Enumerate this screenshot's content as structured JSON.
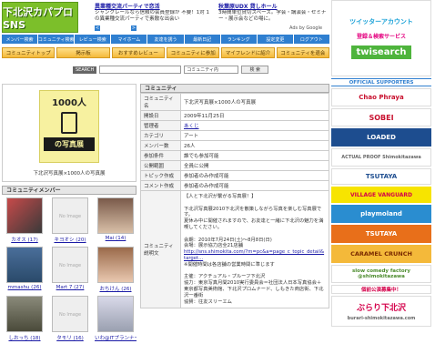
{
  "logo": {
    "text": "下北沢カパプロ SNS"
  },
  "nav": [
    "メンバー検索",
    "コミュニティ検索",
    "レビュー検索",
    "マイホーム",
    "友達を誘う",
    "最新日記",
    "ランキング",
    "設定変更",
    "ログアウト"
  ],
  "ads": {
    "ad1_title": "異業種交流パーティで恋活",
    "ad1_body": "シャンクレールなら信頼の会員登録が 不要！1対 1の異業種交流パーティで素敵な出会い",
    "ad2_title": "秋葉原UDX 貸しホール",
    "ad2_body": "3時間単位貸切スペース。学会・講演会・セミナー・展示会などの場に。",
    "ads_by": "Ads by Google"
  },
  "tabs": [
    "コミュニティトップ",
    "掲示板",
    "おすすめレビュー",
    "コミュニティに参加",
    "マイフレンドに紹介",
    "コミュニティを退会"
  ],
  "search": {
    "label": "SEARCH",
    "select": "コミュニティ内",
    "button": "検 索"
  },
  "community": {
    "poster_top": "1000人",
    "poster_bottom": "の写真展",
    "caption": "下北沢写真展×1000人の写真展",
    "header": "コミュニティ",
    "rows": [
      {
        "label": "コミュニティ名",
        "value": "下北沢写真展×1000人の写真展"
      },
      {
        "label": "開設日",
        "value": "2009年11月25日"
      },
      {
        "label": "管理者",
        "value": "あくじ"
      },
      {
        "label": "カテゴリ",
        "value": "アート"
      },
      {
        "label": "メンバー数",
        "value": "26人"
      },
      {
        "label": "参加条件",
        "value": "誰でも参加可能"
      },
      {
        "label": "公開範囲",
        "value": "全員に公開"
      },
      {
        "label": "トピック作成",
        "value": "参加者のみ作成可能"
      },
      {
        "label": "コメント作成",
        "value": "参加者のみ作成可能"
      }
    ],
    "desc_label": "コミュニティ説明文",
    "description": [
      "【人と下北沢が繋がる写真展！】",
      "下北沢写真展2010下北沢を散策しながら写真を楽しむ写真展です。",
      "夏休み中に開催されますので、お友達と一緒に下北沢の魅力を満喫してください。",
      "会期：2010年7月24日(土)〜8月8日(日)",
      "会場：展示協力店全21店舗",
      "http://sns.shimokita.com/?m=pc&a=page_c_topic_detail&target...",
      "※開催時間は各店舗の営業時間に準じます",
      "主催：アクチュアル・プルーフ下北沢",
      "協力：東京写真月間2010実行委員会＝社団法人日本写真協会＋東京都写真美術館、下北沢プロムナード、しもきた商店街、下北沢一番街",
      "協賛：往友スリーエム"
    ]
  },
  "members": {
    "header": "コミュニティメンバー",
    "list": [
      {
        "name": "カオス (17)"
      },
      {
        "name": "キヨオシ (20)"
      },
      {
        "name": "Mai (14)"
      },
      {
        "name": "mmashu (26)"
      },
      {
        "name": "Mart 7 (27)"
      },
      {
        "name": "おちけん (26)"
      },
      {
        "name": "しおっち (18)"
      },
      {
        "name": "タモリ (16)"
      },
      {
        "name": "いわ@ITプランナー (8)"
      }
    ],
    "noimage": "No Image"
  },
  "right": {
    "twitter_1": "ツイッターアカウント",
    "twitter_2": "登録＆検索サービス",
    "twitter_3": "twisearch",
    "supporters": "OFFICIAL SUPPORTERS",
    "chao": "Chao Phraya",
    "sobei": "SOBEI",
    "loaded": "LOADED",
    "actual": "ACTUAL PROOF Shimokitazawa",
    "tsutaya": "TSUTAYA",
    "village": "VILLAGE VANGUARD",
    "playmo": "playmoland",
    "tsuta2": "TSUTAYA",
    "caramel": "CARAMEL CRUNCH",
    "slow": "slow comedy factory @shimokitazawa",
    "site_banner": "個前公演募集中！",
    "burari_1": "ぶらり下北沢",
    "burari_2": "burari-shimokitazawa.com"
  }
}
